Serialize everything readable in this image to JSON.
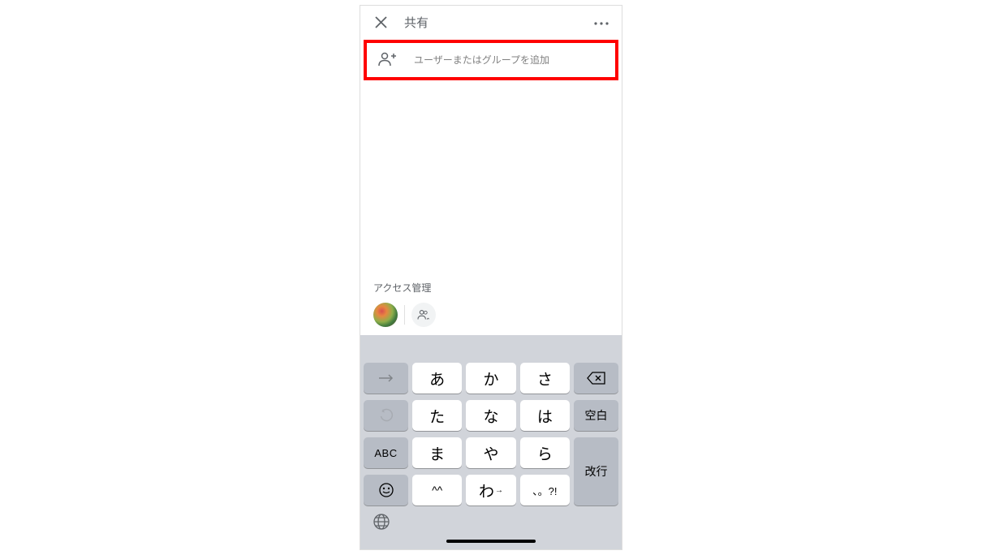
{
  "header": {
    "title": "共有"
  },
  "input": {
    "placeholder": "ユーザーまたはグループを追加"
  },
  "access": {
    "title": "アクセス管理"
  },
  "keyboard": {
    "rows": [
      {
        "left": "→",
        "mids": [
          "あ",
          "か",
          "さ"
        ],
        "right": "⌫"
      },
      {
        "left": "↺",
        "mids": [
          "た",
          "な",
          "は"
        ],
        "right": "空白"
      },
      {
        "left": "ABC",
        "mids": [
          "ま",
          "や",
          "ら"
        ],
        "right": ""
      },
      {
        "left": "☺",
        "mids": [
          "^^",
          "わ",
          "、。?!"
        ],
        "right": "改行"
      }
    ],
    "space_label": "空白",
    "newline_label": "改行",
    "abc_label": "ABC"
  }
}
